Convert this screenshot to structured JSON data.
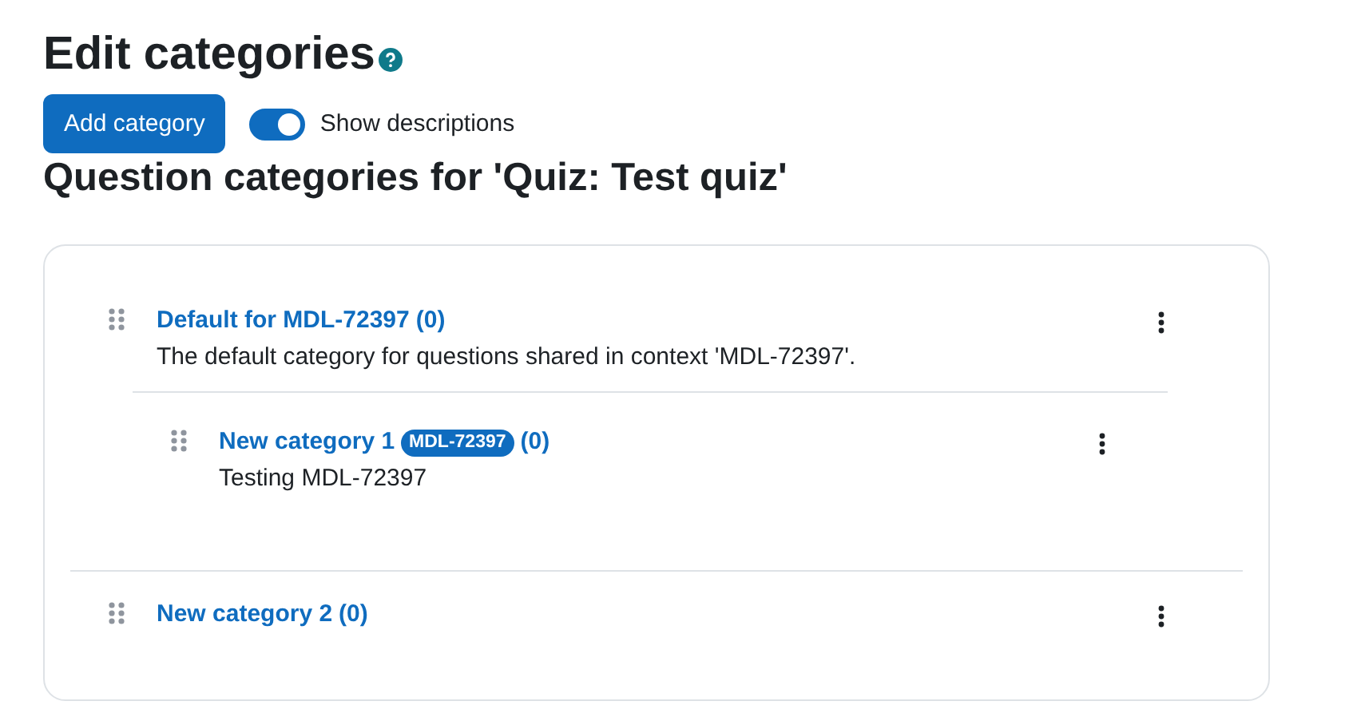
{
  "title": "Edit categories",
  "add_button": "Add category",
  "show_descriptions": {
    "label": "Show descriptions",
    "on": true
  },
  "subtitle": "Question categories for 'Quiz: Test quiz'",
  "categories": [
    {
      "name": "Default for MDL-72397",
      "count": "(0)",
      "description": "The default category for questions shared in context 'MDL-72397'.",
      "children": [
        {
          "name": "New category 1",
          "badge": "MDL-72397",
          "count": "(0)",
          "description": "Testing MDL-72397"
        }
      ]
    },
    {
      "name": "New category 2",
      "count": "(0)"
    }
  ]
}
